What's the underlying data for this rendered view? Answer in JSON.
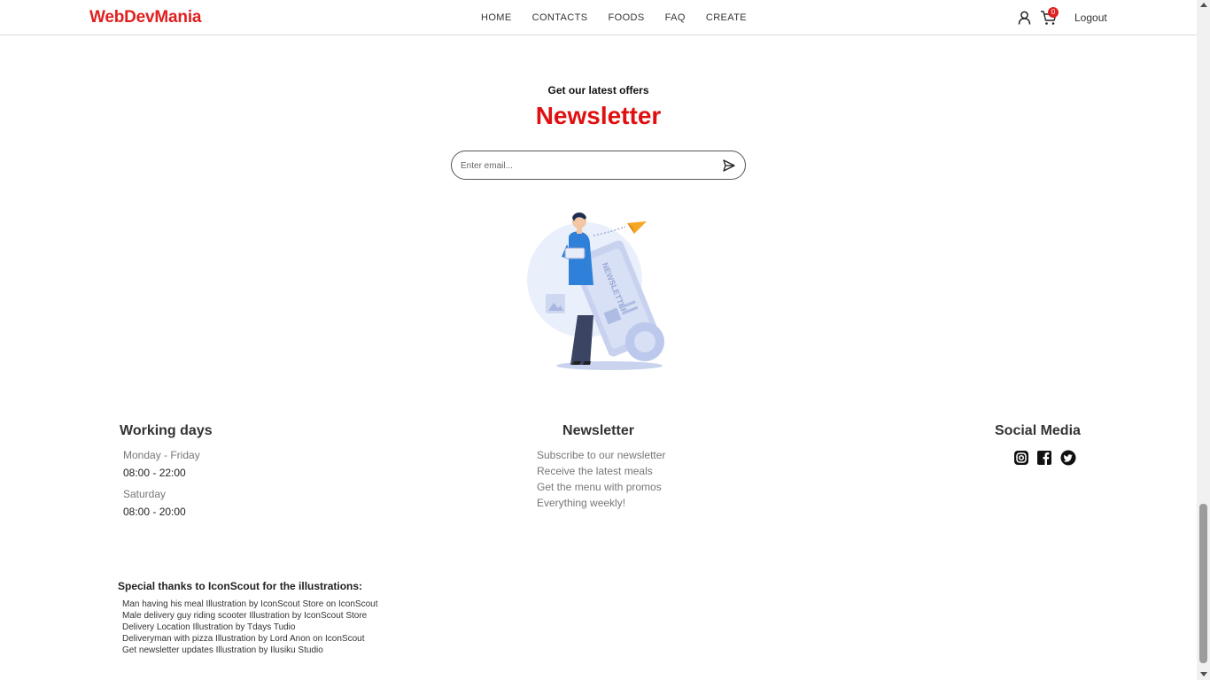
{
  "header": {
    "logo": "WebDevMania",
    "nav": [
      "HOME",
      "CONTACTS",
      "FOODS",
      "FAQ",
      "CREATE"
    ],
    "cart_count": "0",
    "logout": "Logout"
  },
  "hero": {
    "subtitle": "Get our latest offers",
    "title": "Newsletter",
    "email_placeholder": "Enter email..."
  },
  "illustration": {
    "caption": "NEWSLETTER"
  },
  "footer": {
    "working_days": {
      "title": "Working days",
      "schedule": [
        {
          "day": "Monday - Friday",
          "hours": "08:00 - 22:00"
        },
        {
          "day": "Saturday",
          "hours": "08:00 - 20:00"
        }
      ]
    },
    "newsletter": {
      "title": "Newsletter",
      "lines": [
        "Subscribe to our newsletter",
        "Receive the latest meals",
        "Get the menu with promos",
        "Everything weekly!"
      ]
    },
    "social": {
      "title": "Social Media",
      "icons": [
        "instagram-icon",
        "facebook-icon",
        "twitter-icon"
      ]
    }
  },
  "credits": {
    "title": "Special thanks to IconScout for the illustrations:",
    "items": [
      "Man having his meal Illustration by IconScout Store on IconScout",
      "Male delivery guy riding scooter Illustration by IconScout Store",
      "Delivery Location Illustration by Tdays Tudio",
      "Deliveryman with pizza Illustration by Lord Anon on IconScout",
      "Get newsletter updates Illustration by Ilusiku Studio"
    ]
  },
  "colors": {
    "accent": "#e02020",
    "text": "#333333",
    "muted": "#777777"
  }
}
